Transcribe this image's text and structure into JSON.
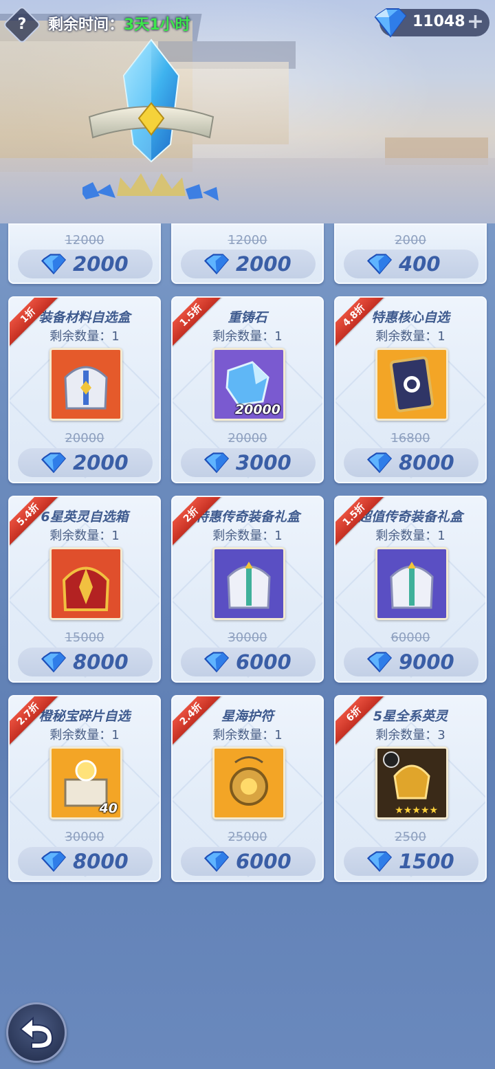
{
  "header": {
    "help_glyph": "?",
    "timer_label": "剩余时间：",
    "timer_value": "3天1小时",
    "currency_amount": "11048",
    "add_glyph": "+"
  },
  "top_row": [
    {
      "old_price": "12000",
      "price": "2000"
    },
    {
      "old_price": "12000",
      "price": "2000"
    },
    {
      "old_price": "2000",
      "price": "400"
    }
  ],
  "items": [
    {
      "discount": "1折",
      "name": "装备材料自选盒",
      "remain": "剩余数量：1",
      "old_price": "20000",
      "price": "2000",
      "qty": "",
      "icon": "armor-chest-icon",
      "bg": "#e5552a"
    },
    {
      "discount": "1.5折",
      "name": "重铸石",
      "remain": "剩余数量：1",
      "old_price": "20000",
      "price": "3000",
      "qty": "20000",
      "icon": "reforge-stone-icon",
      "bg": "#7a5ad0"
    },
    {
      "discount": "4.8折",
      "name": "特惠核心自选",
      "remain": "剩余数量：1",
      "old_price": "16800",
      "price": "8000",
      "qty": "",
      "icon": "core-card-icon",
      "bg": "#f0a22a"
    },
    {
      "discount": "5.4折",
      "name": "6星英灵自选箱",
      "remain": "剩余数量：1",
      "old_price": "15000",
      "price": "8000",
      "qty": "",
      "icon": "hero-helmet-icon",
      "bg": "#e5552a"
    },
    {
      "discount": "2折",
      "name": "特惠传奇装备礼盒",
      "remain": "剩余数量：1",
      "old_price": "30000",
      "price": "6000",
      "qty": "",
      "icon": "legendary-armor-icon",
      "bg": "#5b4fc2"
    },
    {
      "discount": "1.5折",
      "name": "超值传奇装备礼盒",
      "remain": "剩余数量：1",
      "old_price": "60000",
      "price": "9000",
      "qty": "",
      "icon": "legendary-armor-icon",
      "bg": "#5b4fc2"
    },
    {
      "discount": "2.7折",
      "name": "橙秘宝碎片自选",
      "remain": "剩余数量：1",
      "old_price": "30000",
      "price": "8000",
      "qty": "40",
      "icon": "treasure-altar-icon",
      "bg": "#f0a22a"
    },
    {
      "discount": "2.4折",
      "name": "星海护符",
      "remain": "剩余数量：1",
      "old_price": "25000",
      "price": "6000",
      "qty": "",
      "icon": "amulet-icon",
      "bg": "#f0a22a"
    },
    {
      "discount": "6折",
      "name": "5星全系英灵",
      "remain": "剩余数量：3",
      "old_price": "2500",
      "price": "1500",
      "qty": "",
      "icon": "five-star-hero-icon",
      "bg": "#3a2a18"
    }
  ],
  "colors": {
    "accent_green": "#3ee64c",
    "price_blue": "#3a5ea6",
    "ribbon_red": "#d63b2c"
  }
}
